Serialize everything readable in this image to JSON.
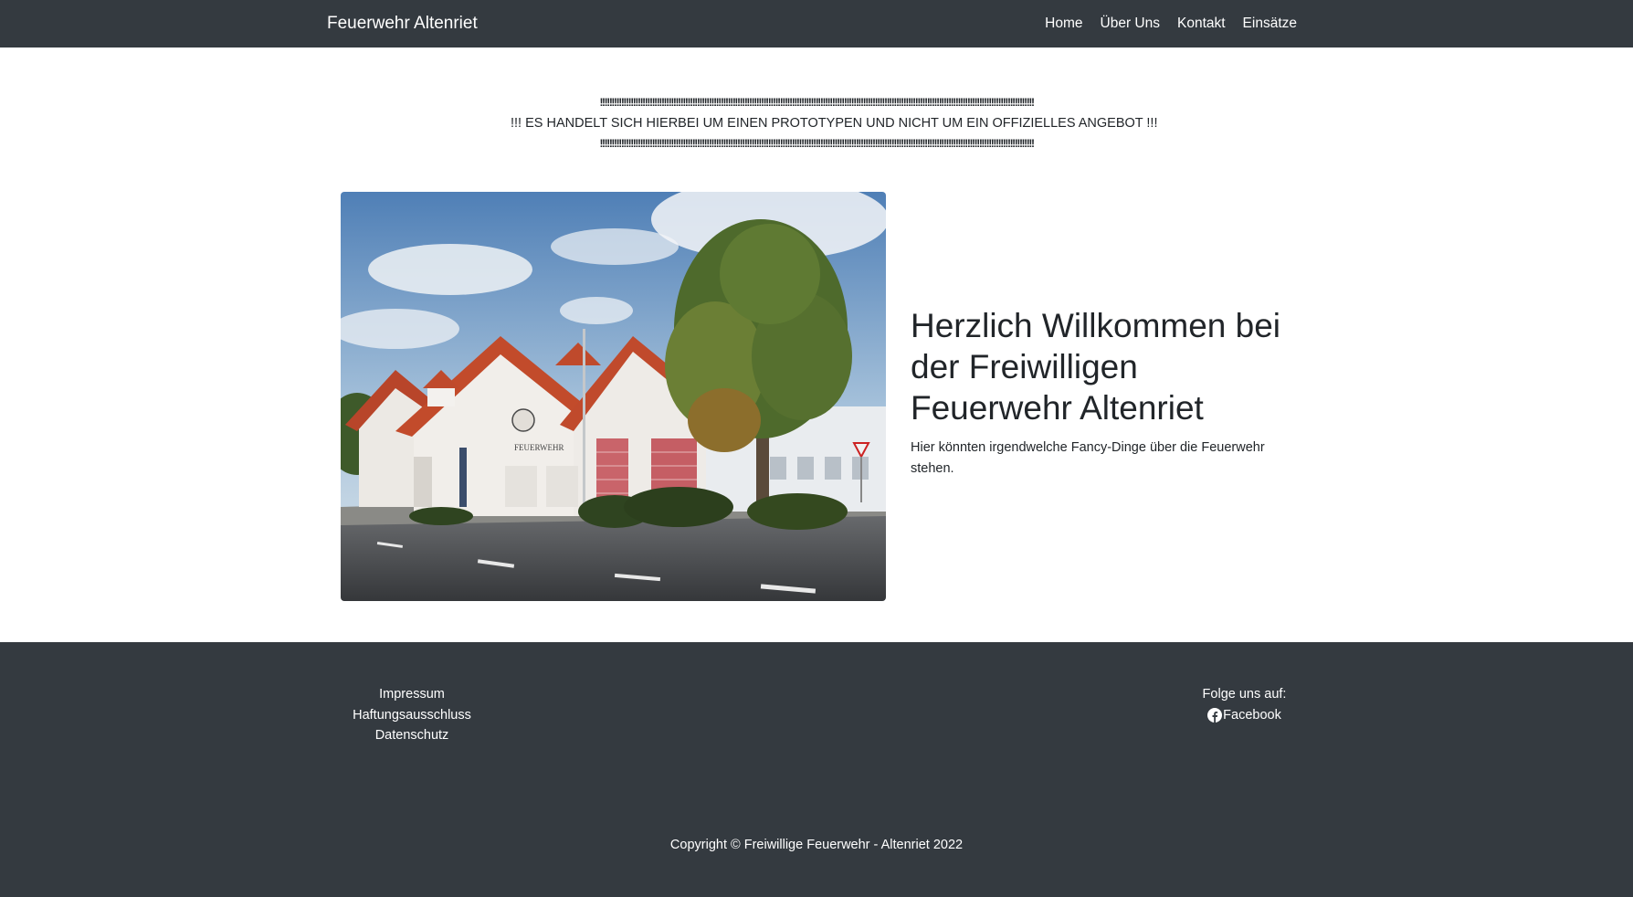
{
  "navbar": {
    "brand": "Feuerwehr Altenriet",
    "links": [
      "Home",
      "Über Uns",
      "Kontakt",
      "Einsätze"
    ]
  },
  "notice": {
    "bangs": "!!!!!!!!!!!!!!!!!!!!!!!!!!!!!!!!!!!!!!!!!!!!!!!!!!!!!!!!!!!!!!!!!!!!!!!!!!!!!!!!!!!!!!!!!!!!!!!!!!!!!!!!!!!!!!!!!!!!!!!!!!!!!!!!!!!!!!!!!!!!!!!!!!!!!!!!!!!!!!!!!!!!!!!!!!!!!!!!!!!!!!!",
    "message": "!!! ES HANDELT SICH HIERBEI UM EINEN PROTOTYPEN UND NICHT UM EIN OFFIZIELLES ANGEBOT !!!"
  },
  "hero": {
    "title": "Herzlich Willkommen bei der Freiwilligen Feuerwehr Altenriet",
    "subtitle": "Hier könnten irgendwelche Fancy-Dinge über die Feuerwehr stehen.",
    "image_sign": "FEUERWEHR"
  },
  "footer": {
    "links": [
      "Impressum",
      "Haftungsausschluss",
      "Datenschutz"
    ],
    "follow_label": "Folge uns auf:",
    "facebook_label": "Facebook",
    "facebook_icon": "facebook-icon",
    "copyright": "Copyright © Freiwillige Feuerwehr - Altenriet 2022"
  },
  "colors": {
    "dark": "#343a40",
    "text": "#212529",
    "white": "#ffffff"
  }
}
